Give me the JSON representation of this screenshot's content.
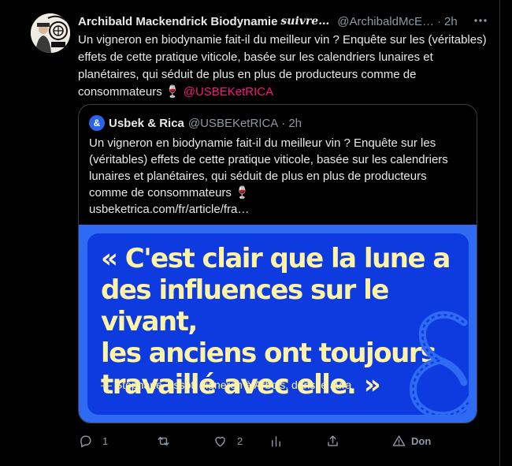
{
  "tweet": {
    "author_name": "Archibald Mackendrick Biodynamie",
    "author_extra": "suivre…",
    "handle": "@ArchibaldMcE…",
    "separator": "·",
    "time": "2h",
    "more_icon": "more-icon",
    "text": "Un vigneron en biodynamie fait-il du meilleur vin ? Enquête sur les (véritables) effets de cette pratique viticole, basée sur les calendriers lunaires et planétaires, qui séduit de plus en plus de producteurs comme de consommateurs 🍷 ",
    "mention": "@USBEKetRICA"
  },
  "quote": {
    "avatar_glyph": "&",
    "name": "Usbek & Rica",
    "handle": "@USBEKetRICA",
    "separator": "·",
    "time": "2h",
    "text": "Un vigneron en biodynamie fait-il du meilleur vin ? Enquête sur les (véritables) effets de cette pratique viticole, basée sur les calendriers lunaires et planétaires, qui séduit de plus en plus de producteurs comme de consommateurs 🍷",
    "link": "usbeketrica.com/fr/article/fra…",
    "image": {
      "quote_line_1": "« C'est clair que la lune a",
      "quote_line_2": "des influences sur le vivant,",
      "quote_line_3": "les anciens ont toujours",
      "quote_line_4": "travaillé avec elle. »",
      "attribution": "—  Stéphane Tissot, vigneron à Arbois, dans le Jura",
      "background_color": "#2f6af3",
      "card_color": "#0d3be0",
      "text_color": "#fff3a6"
    }
  },
  "actions": {
    "reply_count": "1",
    "retweet_count": "",
    "like_count": "2",
    "donate_label": "Don"
  },
  "colors": {
    "background": "#000000",
    "text": "#e7e9ea",
    "secondary": "#8b98a5",
    "mention": "#f91880",
    "border": "#3a3f44"
  }
}
